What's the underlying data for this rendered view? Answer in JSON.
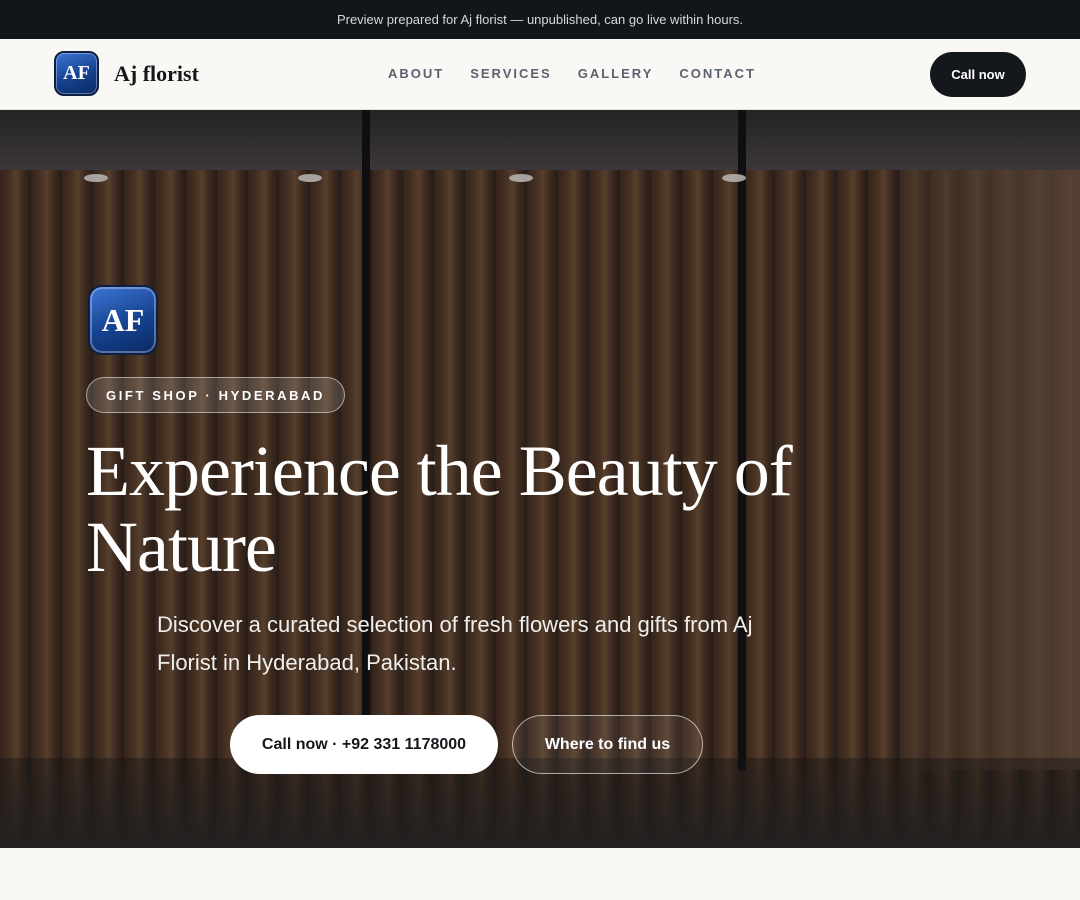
{
  "topbar": {
    "text": "Preview prepared for Aj florist — unpublished, can go live within hours."
  },
  "header": {
    "logo_text": "AF",
    "brand_name": "Aj florist",
    "nav": [
      {
        "label": "ABOUT"
      },
      {
        "label": "SERVICES"
      },
      {
        "label": "GALLERY"
      },
      {
        "label": "CONTACT"
      }
    ],
    "cta_label": "Call now"
  },
  "hero": {
    "logo_text": "AF",
    "badge": "GIFT SHOP · HYDERABAD",
    "headline": "Experience the Beauty of Nature",
    "subtext": "Discover a curated selection of fresh flowers and gifts from Aj Florist in Hyderabad, Pakistan.",
    "primary_button": "Call now · +92 331 1178000",
    "secondary_button": "Where to find us"
  },
  "colors": {
    "dark": "#14171c",
    "background": "#faf8f4",
    "logo_blue": "#15428f"
  }
}
